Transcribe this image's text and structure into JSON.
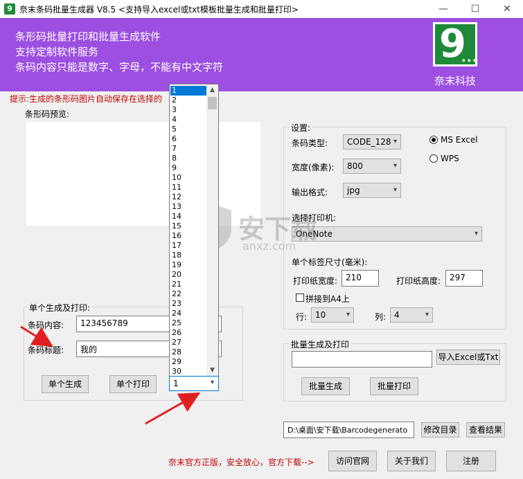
{
  "window": {
    "title": "奈末条码批量生成器 V8.5    <支持导入excel或txt模板批量生成和批量打印>",
    "minimize": "—",
    "maximize": "☐",
    "close": "✕"
  },
  "banner": {
    "line1": "条形码批量打印和批量生成软件",
    "line2": "支持定制软件服务",
    "line3": "条码内容只能是数字、字母，不能有中文字符",
    "logo_digit": "9",
    "logo_dots": "...",
    "logo_name": "奈末科技"
  },
  "hint": "提示:生成的条形码图片自动保存在选择的",
  "preview_label": "条形码预览:",
  "single": {
    "group_label": "单个生成及打印:",
    "content_label": "条码内容:",
    "content_value": "123456789",
    "title_label": "条码标题:",
    "title_value": "我的",
    "generate_button": "单个生成",
    "print_button": "单个打印"
  },
  "dropdown": {
    "items": [
      "1",
      "2",
      "3",
      "4",
      "5",
      "6",
      "7",
      "8",
      "9",
      "10",
      "11",
      "12",
      "13",
      "14",
      "15",
      "16",
      "17",
      "18",
      "19",
      "20",
      "21",
      "22",
      "23",
      "24",
      "25",
      "26",
      "27",
      "28",
      "29",
      "30"
    ],
    "selected": "1"
  },
  "settings": {
    "group_label": "设置:",
    "type_label": "条码类型:",
    "type_value": "CODE_128",
    "width_label": "宽度(像素):",
    "width_value": "800",
    "format_label": "输出格式:",
    "format_value": "jpg",
    "radio_excel": "MS  Excel",
    "radio_wps": "WPS",
    "printer_label": "选择打印机:",
    "printer_value": "OneNote",
    "size_label": "单个标签尺寸(毫米):",
    "paper_width_label": "打印纸宽度:",
    "paper_width_value": "210",
    "paper_height_label": "打印纸高度:",
    "paper_height_value": "297",
    "a4_label": "拼接到A4上",
    "row_label": "行:",
    "row_value": "10",
    "col_label": "列:",
    "col_value": "4"
  },
  "batch": {
    "group_label": "批量生成及打印",
    "path_value": "",
    "import_button": "导入Excel或Txt",
    "generate_button": "批量生成",
    "print_button": "批量打印"
  },
  "output": {
    "dir_value": "D:\\桌面\\安下载\\Barcodegenerato",
    "change_dir_button": "修改目录",
    "view_result_button": "查看结果"
  },
  "footer": {
    "notice": "奈末官方正版，安全放心，官方下载-->",
    "website_button": "访问官网",
    "about_button": "关于我们",
    "register_button": "注册"
  },
  "watermark": {
    "text": "安下载",
    "url": "anxz.com"
  },
  "colors": {
    "banner": "#9c4fe0",
    "logo": "#1e8a3a",
    "hint": "#c00000",
    "selection": "#0078d7",
    "arrow": "#e02020"
  }
}
